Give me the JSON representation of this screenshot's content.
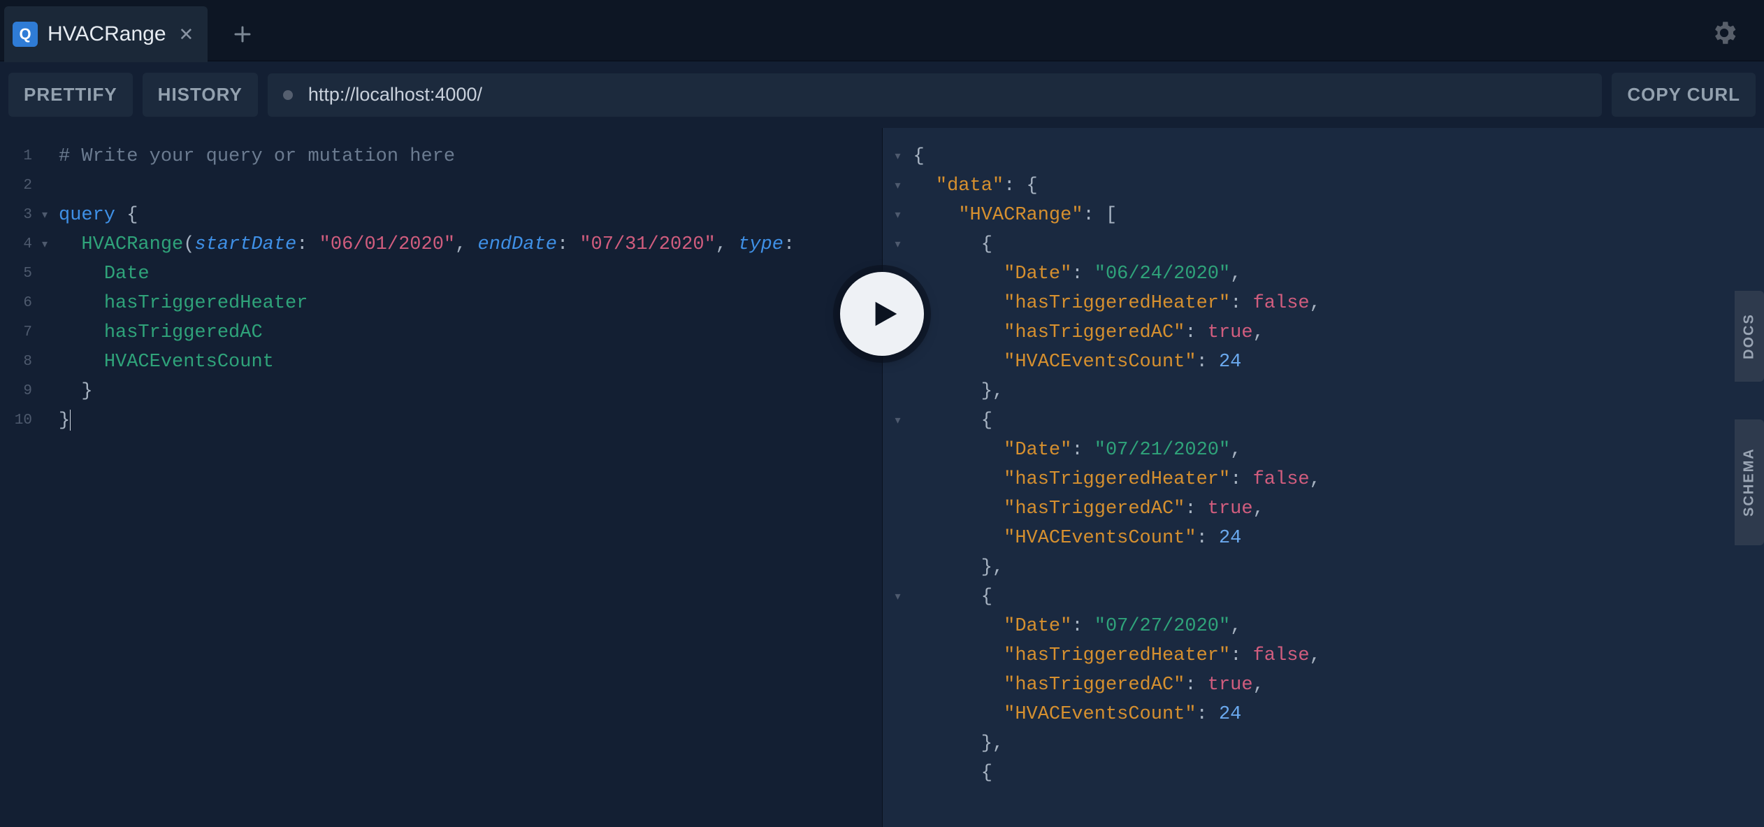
{
  "tabs": {
    "active_badge": "Q",
    "active_label": "HVACRange"
  },
  "toolbar": {
    "prettify": "PRETTIFY",
    "history": "HISTORY",
    "copycurl": "COPY CURL",
    "endpoint": "http://localhost:4000/"
  },
  "side": {
    "docs": "DOCS",
    "schema": "SCHEMA"
  },
  "query": {
    "line_count": 10,
    "comment": "# Write your query or mutation here",
    "keyword": "query",
    "root_field": "HVACRange",
    "arg1_name": "startDate",
    "arg1_val": "\"06/01/2020\"",
    "arg2_name": "endDate",
    "arg2_val": "\"07/31/2020\"",
    "arg3_name": "type",
    "sel_1": "Date",
    "sel_2": "hasTriggeredHeater",
    "sel_3": "hasTriggeredAC",
    "sel_4": "HVACEventsCount"
  },
  "result": {
    "data_key": "\"data\"",
    "range_key": "\"HVACRange\"",
    "records": [
      {
        "Date": "\"06/24/2020\"",
        "hasTriggeredHeater": "false",
        "hasTriggeredAC": "true",
        "HVACEventsCount": "24"
      },
      {
        "Date": "\"07/21/2020\"",
        "hasTriggeredHeater": "false",
        "hasTriggeredAC": "true",
        "HVACEventsCount": "24"
      },
      {
        "Date": "\"07/27/2020\"",
        "hasTriggeredHeater": "false",
        "hasTriggeredAC": "true",
        "HVACEventsCount": "24"
      }
    ],
    "keys": {
      "Date": "\"Date\"",
      "heater": "\"hasTriggeredHeater\"",
      "ac": "\"hasTriggeredAC\"",
      "count": "\"HVACEventsCount\""
    }
  }
}
